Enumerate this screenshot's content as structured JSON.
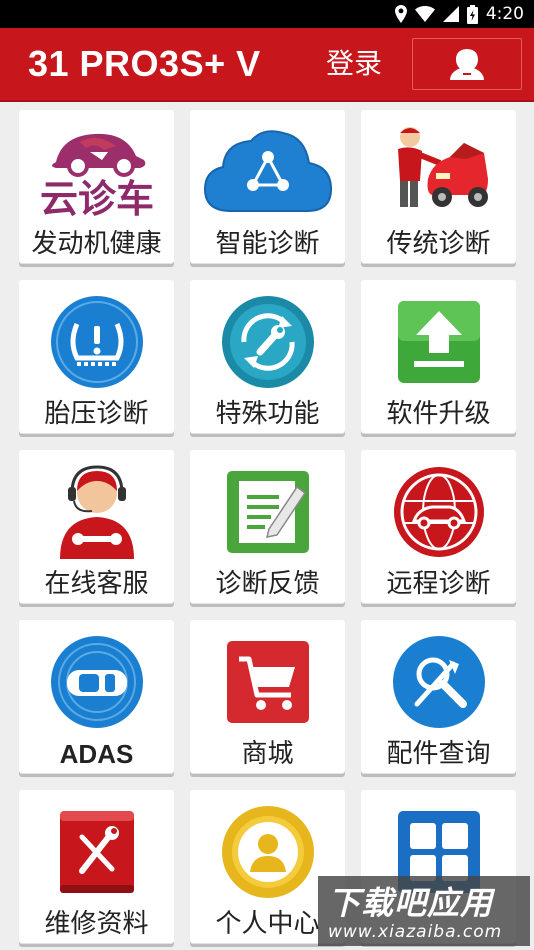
{
  "status_bar": {
    "time": "4:20",
    "icons": [
      "location-icon",
      "wifi-icon",
      "signal-icon",
      "battery-icon"
    ]
  },
  "header": {
    "title": "31 PRO3S+ V",
    "login_label": "登录",
    "user_button_icon": "user-avatar-icon",
    "background_color": "#c8161d"
  },
  "tiles": [
    {
      "label": "发动机健康",
      "icon": "yunzhenche-logo",
      "logo_text": "云诊车"
    },
    {
      "label": "智能诊断",
      "icon": "cloud-share-icon"
    },
    {
      "label": "传统诊断",
      "icon": "mechanic-car-icon"
    },
    {
      "label": "胎压诊断",
      "icon": "tire-pressure-icon"
    },
    {
      "label": "特殊功能",
      "icon": "wrench-refresh-icon"
    },
    {
      "label": "软件升级",
      "icon": "upload-icon"
    },
    {
      "label": "在线客服",
      "icon": "customer-service-icon"
    },
    {
      "label": "诊断反馈",
      "icon": "feedback-note-icon"
    },
    {
      "label": "远程诊断",
      "icon": "remote-car-icon"
    },
    {
      "label": "ADAS",
      "icon": "adas-car-icon"
    },
    {
      "label": "商城",
      "icon": "shopping-cart-icon"
    },
    {
      "label": "配件查询",
      "icon": "parts-search-icon"
    },
    {
      "label": "维修资料",
      "icon": "repair-book-icon"
    },
    {
      "label": "个人中心",
      "icon": "personal-center-icon"
    },
    {
      "label": "",
      "icon": "grid-apps-icon"
    }
  ],
  "watermark": {
    "title": "下载吧应用",
    "url": "www.xiazaiba.com"
  }
}
